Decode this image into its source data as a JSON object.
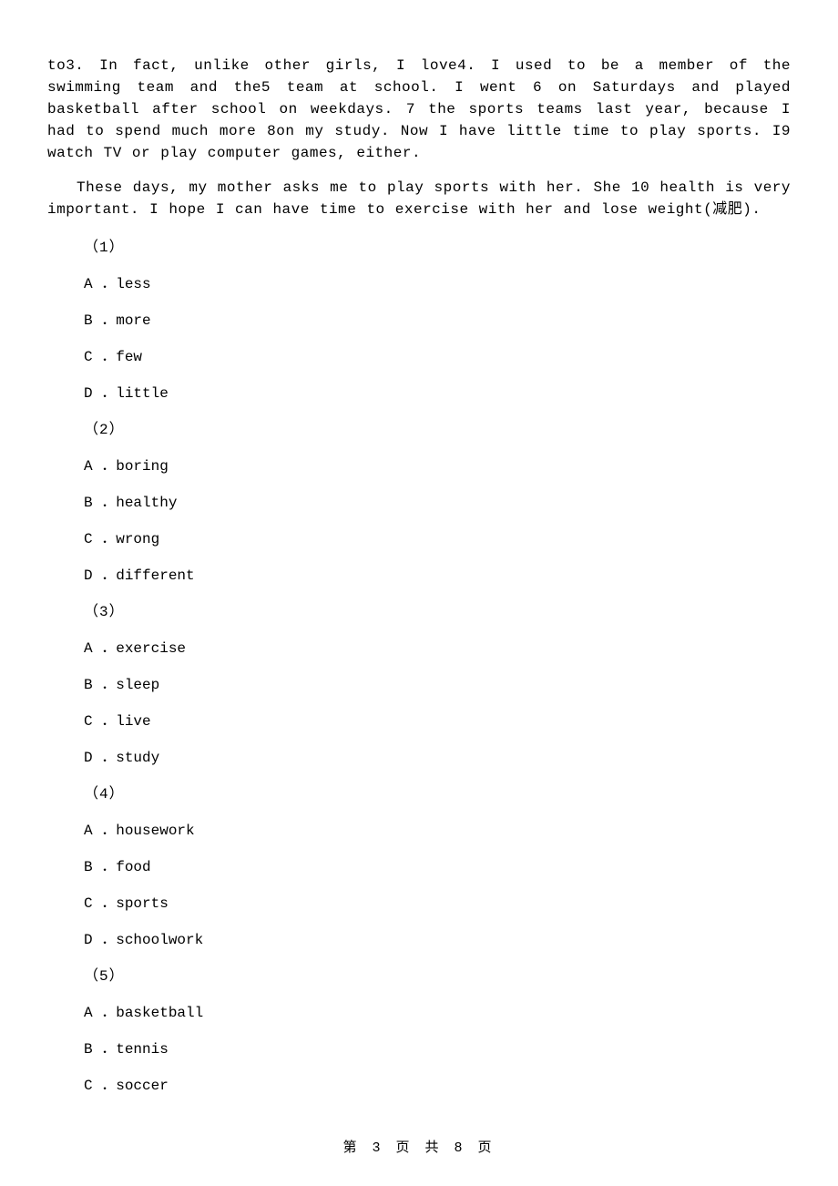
{
  "paragraphs": {
    "p1": "to3. In fact, unlike other girls, I love4. I used to be a member of the swimming team and the5  team at school. I went 6  on Saturdays and played basketball after school on weekdays. 7  the sports teams last year, because I had to spend much more 8on my study. Now I have little time to play sports. I9  watch TV or play computer games, either.",
    "p2": "These days, my mother asks me to play sports with her. She 10  health is very important. I hope I can have time to exercise with her and lose weight(减肥)."
  },
  "questions": [
    {
      "num": "（1）",
      "options": [
        {
          "label": "A ．",
          "text": "less"
        },
        {
          "label": "B ．",
          "text": "more"
        },
        {
          "label": "C ．",
          "text": "few"
        },
        {
          "label": "D ．",
          "text": "little"
        }
      ]
    },
    {
      "num": "（2）",
      "options": [
        {
          "label": "A ．",
          "text": "boring"
        },
        {
          "label": "B ．",
          "text": "healthy"
        },
        {
          "label": "C ．",
          "text": "wrong"
        },
        {
          "label": "D ．",
          "text": "different"
        }
      ]
    },
    {
      "num": "（3）",
      "options": [
        {
          "label": "A ．",
          "text": "exercise"
        },
        {
          "label": "B ．",
          "text": "sleep"
        },
        {
          "label": "C ．",
          "text": "live"
        },
        {
          "label": "D ．",
          "text": "study"
        }
      ]
    },
    {
      "num": "（4）",
      "options": [
        {
          "label": "A ．",
          "text": "housework"
        },
        {
          "label": "B ．",
          "text": "food"
        },
        {
          "label": "C ．",
          "text": "sports"
        },
        {
          "label": "D ．",
          "text": "schoolwork"
        }
      ]
    },
    {
      "num": "（5）",
      "options": [
        {
          "label": "A ．",
          "text": "basketball"
        },
        {
          "label": "B ．",
          "text": "tennis"
        },
        {
          "label": "C ．",
          "text": "soccer"
        }
      ]
    }
  ],
  "footer": "第 3 页 共 8 页"
}
